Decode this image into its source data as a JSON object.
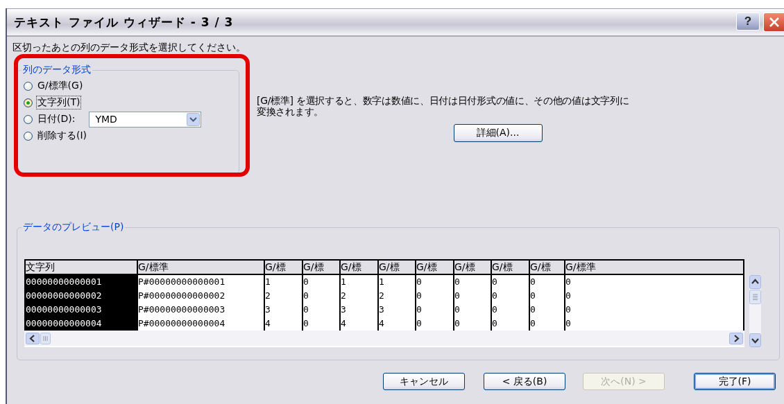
{
  "window": {
    "title": "テキスト ファイル ウィザード - 3 / 3",
    "buttons": [
      "?"
    ]
  },
  "instruction": "区切ったあとの列のデータ形式を選択してください。",
  "format_group": {
    "legend": "列のデータ形式",
    "highlighted": true,
    "options": [
      {
        "kind": "radio",
        "label": "G/標準(G)",
        "selected": false
      },
      {
        "kind": "radio",
        "label": "文字列(T)",
        "selected": true
      },
      {
        "kind": "radio_dropdown",
        "label": "日付(D):",
        "selected": false,
        "value": "YMD"
      },
      {
        "kind": "radio",
        "label": "削除する(I)",
        "selected": false
      }
    ]
  },
  "description": {
    "lines": [
      "[G/標準] を選択すると、数字は数値に、日付は日付形式の値に、その他の値は文字列に",
      "変換されます。"
    ]
  },
  "advanced_button": "詳細(A)...",
  "preview": {
    "legend": "データのプレビュー(P)",
    "columns": [
      {
        "label": "文字列",
        "selected": true
      },
      {
        "label": "G/標準",
        "selected": false
      },
      {
        "label": "G/標",
        "selected": false
      },
      {
        "label": "G/標",
        "selected": false
      },
      {
        "label": "G/標",
        "selected": false
      },
      {
        "label": "G/標",
        "selected": false
      },
      {
        "label": "G/標",
        "selected": false
      },
      {
        "label": "G/標",
        "selected": false
      },
      {
        "label": "G/標",
        "selected": false
      },
      {
        "label": "G/標",
        "selected": false
      },
      {
        "label": "G/標準",
        "selected": false
      }
    ],
    "rows": [
      [
        "00000000000001",
        "P#00000000000001",
        "1",
        "0",
        "1",
        "1",
        "0",
        "0",
        "0",
        "0",
        "0"
      ],
      [
        "00000000000002",
        "P#00000000000002",
        "2",
        "0",
        "2",
        "2",
        "0",
        "0",
        "0",
        "0",
        "0"
      ],
      [
        "00000000000003",
        "P#00000000000003",
        "3",
        "0",
        "3",
        "3",
        "0",
        "0",
        "0",
        "0",
        "0"
      ],
      [
        "00000000000004",
        "P#00000000000004",
        "4",
        "0",
        "4",
        "4",
        "0",
        "0",
        "0",
        "0",
        "0"
      ]
    ]
  },
  "footer_buttons": [
    {
      "label": "キャンセル",
      "disabled": false,
      "default": false
    },
    {
      "label": "< 戻る(B)",
      "disabled": false,
      "default": false
    },
    {
      "label": "次へ(N) >",
      "disabled": true,
      "default": false
    },
    {
      "label": "完了(F)",
      "disabled": false,
      "default": true
    }
  ]
}
